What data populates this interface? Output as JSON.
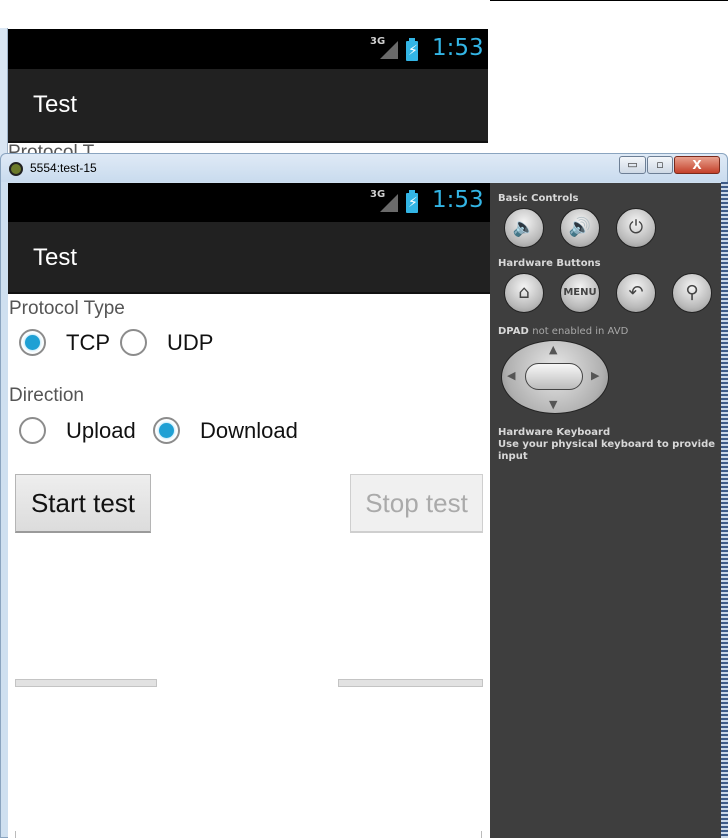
{
  "background_emulator": {
    "status": {
      "network": "3G",
      "time": "1:53"
    },
    "app_title": "Test",
    "peek_text": "Protocol T"
  },
  "window": {
    "title": "5554:test-15",
    "buttons": {
      "minimize": "▭",
      "maximize": "▫",
      "close": "X"
    }
  },
  "device": {
    "status": {
      "network": "3G",
      "time": "1:53"
    },
    "app_title": "Test",
    "protocol": {
      "label": "Protocol Type",
      "options": [
        {
          "label": "TCP",
          "checked": true
        },
        {
          "label": "UDP",
          "checked": false
        }
      ]
    },
    "direction": {
      "label": "Direction",
      "options": [
        {
          "label": "Upload",
          "checked": false
        },
        {
          "label": "Download",
          "checked": true
        }
      ]
    },
    "buttons": {
      "start": "Start test",
      "stop": "Stop test"
    }
  },
  "controls": {
    "basic_title": "Basic Controls",
    "hardware_title": "Hardware Buttons",
    "menu_label": "MENU",
    "dpad_title": "DPAD",
    "dpad_note": "not enabled in AVD",
    "keyboard_title": "Hardware Keyboard",
    "keyboard_note": "Use your physical keyboard to provide input"
  },
  "icons": [
    "volume-down-icon",
    "volume-up-icon",
    "power-icon",
    "home-icon",
    "back-icon",
    "search-icon"
  ],
  "colors": {
    "accent": "#33b5e5",
    "radio_checked": "#1ea0d4",
    "actionbar": "#212121",
    "panel": "#3e3e3e"
  }
}
